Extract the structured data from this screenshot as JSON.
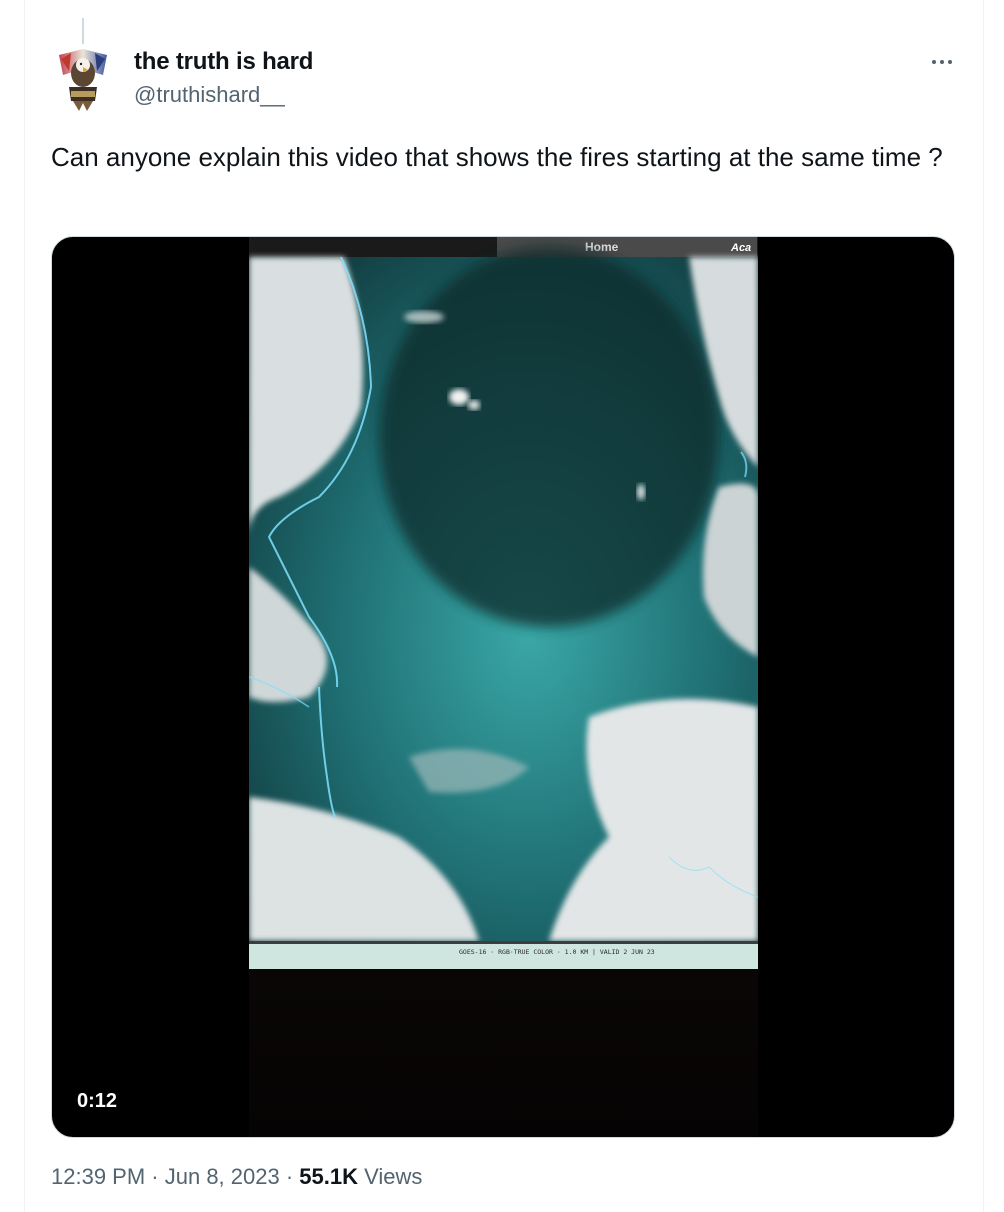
{
  "author": {
    "display_name": "the truth is hard",
    "handle": "@truthishard__"
  },
  "tweet": {
    "text": "Can anyone explain this video that shows the fires starting at the same time ?",
    "posted_time": "12:39 PM",
    "separator": " · ",
    "posted_date": "Jun 8, 2023",
    "views_count": "55.1K",
    "views_label": " Views"
  },
  "video": {
    "duration": "0:12",
    "frame_top_label": "Home",
    "frame_top_right_label": "Aca",
    "frame_caption": "GOES-16 · RGB·TRUE COLOR · 1.0 KM | VALID 2 JUN 23"
  },
  "colors": {
    "text_primary": "#0f1419",
    "text_secondary": "#536471",
    "border": "#cfd9de",
    "water": "#2f8f8c"
  },
  "icons": {
    "more": "more-horizontal-icon"
  }
}
